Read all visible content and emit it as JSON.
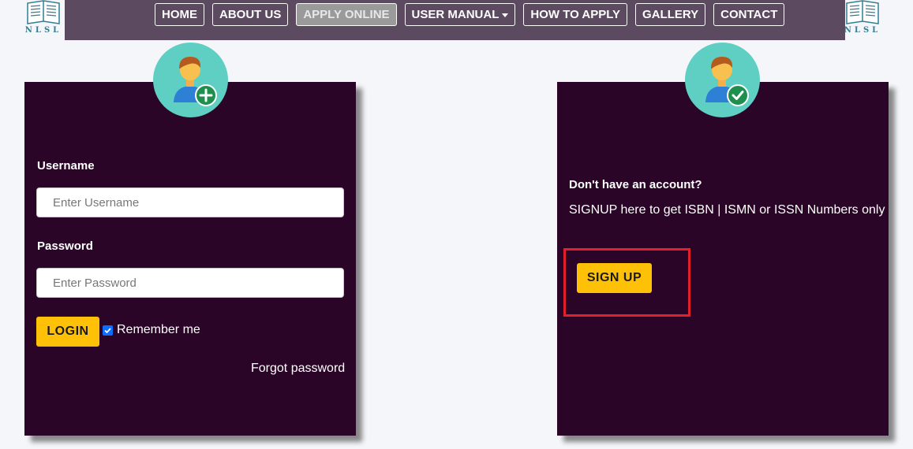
{
  "header": {
    "logo_text": "NLSL",
    "nav": [
      {
        "label": "HOME"
      },
      {
        "label": "ABOUT US"
      },
      {
        "label": "APPLY ONLINE",
        "active": true
      },
      {
        "label": "USER MANUAL",
        "dropdown": true
      },
      {
        "label": "HOW TO APPLY"
      },
      {
        "label": "GALLERY"
      },
      {
        "label": "CONTACT"
      }
    ]
  },
  "login": {
    "avatar_icon": "user-add-icon",
    "username_label": "Username",
    "username_placeholder": "Enter Username",
    "password_label": "Password",
    "password_placeholder": "Enter Password",
    "login_label": "LOGIN",
    "remember_label": "Remember me",
    "remember_checked": true,
    "forgot_label": "Forgot password"
  },
  "signup": {
    "avatar_icon": "user-check-icon",
    "question": "Don't have an account?",
    "description": "SIGNUP here to get ISBN | ISMN or ISSN Numbers only",
    "signup_label": "SIGN UP"
  },
  "colors": {
    "card_bg": "#2b0527",
    "topbar_bg": "#5c4a60",
    "accent": "#ffc107",
    "avatar_bg": "#5fcfc3",
    "highlight": "#e0202a"
  }
}
